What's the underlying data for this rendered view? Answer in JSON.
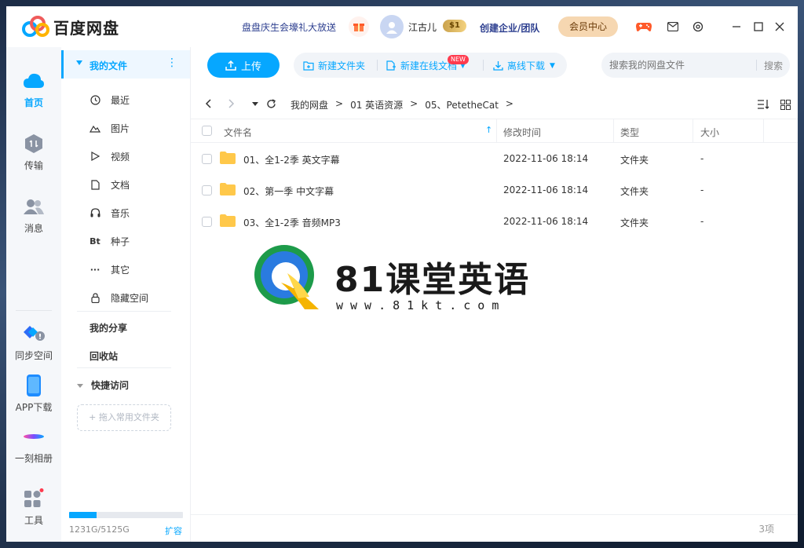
{
  "titlebar": {
    "app_name": "百度网盘",
    "promo": "盘盘庆生会壕礼大放送",
    "username": "江古儿",
    "coin_badge": "$1",
    "enterprise": "创建企业/团队",
    "vip": "会员中心"
  },
  "rail": {
    "items": [
      {
        "label": "首页"
      },
      {
        "label": "传输"
      },
      {
        "label": "消息"
      },
      {
        "label": "同步空间"
      },
      {
        "label": "APP下载"
      },
      {
        "label": "一刻相册"
      },
      {
        "label": "工具"
      }
    ]
  },
  "sidebar": {
    "my_files": "我的文件",
    "items": [
      {
        "label": "最近",
        "icon": "clock-icon"
      },
      {
        "label": "图片",
        "icon": "image-icon"
      },
      {
        "label": "视频",
        "icon": "play-icon"
      },
      {
        "label": "文档",
        "icon": "document-icon"
      },
      {
        "label": "音乐",
        "icon": "headphones-icon"
      },
      {
        "label": "种子",
        "icon": "bt-icon",
        "glyph": "Bt"
      },
      {
        "label": "其它",
        "icon": "more-icon",
        "glyph": "···"
      },
      {
        "label": "隐藏空间",
        "icon": "lock-icon"
      }
    ],
    "my_share": "我的分享",
    "recycle": "回收站",
    "quick_access": "快捷访问",
    "drop_zone": "+ 拖入常用文件夹",
    "storage_text": "1231G/5125G",
    "storage_used_fraction": 0.24,
    "expand": "扩容"
  },
  "toolbar": {
    "upload": "上传",
    "new_folder": "新建文件夹",
    "new_doc": "新建在线文档",
    "new_badge": "NEW",
    "offline": "离线下载",
    "search_placeholder": "搜索我的网盘文件",
    "search_btn": "搜索"
  },
  "breadcrumb": {
    "items": [
      "我的网盘",
      ">",
      "01 英语资源",
      ">",
      "05、PetetheCat",
      ">"
    ]
  },
  "table": {
    "headers": {
      "name": "文件名",
      "time": "修改时间",
      "type": "类型",
      "size": "大小"
    },
    "rows": [
      {
        "name": "01、全1-2季 英文字幕",
        "time": "2022-11-06 18:14",
        "type": "文件夹",
        "size": "-"
      },
      {
        "name": "02、第一季 中文字幕",
        "time": "2022-11-06 18:14",
        "type": "文件夹",
        "size": "-"
      },
      {
        "name": "03、全1-2季 音频MP3",
        "time": "2022-11-06 18:14",
        "type": "文件夹",
        "size": "-"
      }
    ]
  },
  "watermark": {
    "title": "81课堂英语",
    "url": "www.81kt.com"
  },
  "footer": {
    "count": "3项"
  },
  "colors": {
    "accent": "#06a7ff",
    "vip_bg": "#f6d7b1",
    "folder": "#ffc84a"
  }
}
